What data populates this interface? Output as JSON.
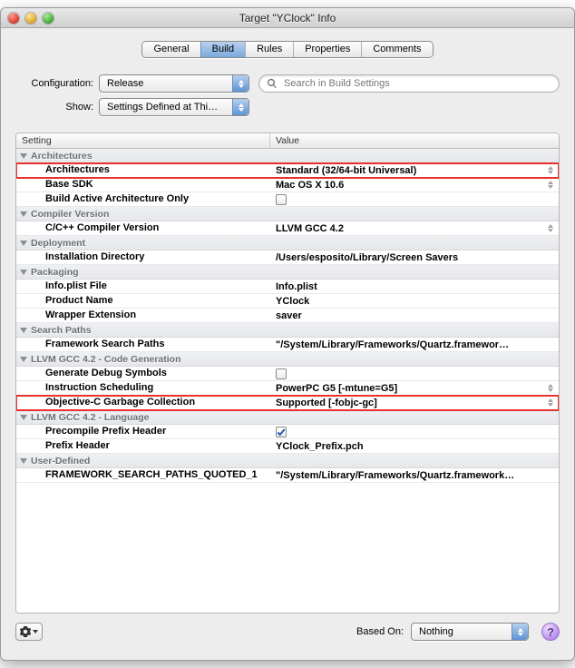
{
  "window": {
    "title": "Target \"YClock\" Info"
  },
  "tabs": [
    "General",
    "Build",
    "Rules",
    "Properties",
    "Comments"
  ],
  "active_tab": 1,
  "config": {
    "label": "Configuration:",
    "value": "Release",
    "show_label": "Show:",
    "show_value": "Settings Defined at Thi…",
    "search_placeholder": "Search in Build Settings"
  },
  "columns": {
    "setting": "Setting",
    "value": "Value"
  },
  "sections": [
    {
      "title": "Architectures",
      "rows": [
        {
          "key": "Architectures",
          "val": "Standard (32/64-bit Universal)",
          "bold": true,
          "hl": true,
          "stepper": true
        },
        {
          "key": "Base SDK",
          "val": "Mac OS X 10.6",
          "bold": true,
          "stepper": true
        },
        {
          "key": "Build Active Architecture Only",
          "val": "",
          "bold": true,
          "check": false
        }
      ]
    },
    {
      "title": "Compiler Version",
      "rows": [
        {
          "key": "C/C++ Compiler Version",
          "val": "LLVM GCC 4.2",
          "bold": true,
          "stepper": true
        }
      ]
    },
    {
      "title": "Deployment",
      "rows": [
        {
          "key": "Installation Directory",
          "val": "/Users/esposito/Library/Screen Savers",
          "bold": true
        }
      ]
    },
    {
      "title": "Packaging",
      "rows": [
        {
          "key": "Info.plist File",
          "val": "Info.plist",
          "bold": true
        },
        {
          "key": "Product Name",
          "val": "YClock",
          "bold": true
        },
        {
          "key": "Wrapper Extension",
          "val": "saver",
          "bold": true
        }
      ]
    },
    {
      "title": "Search Paths",
      "rows": [
        {
          "key": "Framework Search Paths",
          "val": "\"/System/Library/Frameworks/Quartz.framewor…",
          "bold": true
        }
      ]
    },
    {
      "title": "LLVM GCC 4.2 - Code Generation",
      "rows": [
        {
          "key": "Generate Debug Symbols",
          "val": "",
          "bold": true,
          "check": false
        },
        {
          "key": "Instruction Scheduling",
          "val": "PowerPC G5 [-mtune=G5]",
          "bold": true,
          "stepper": true
        },
        {
          "key": "Objective-C Garbage Collection",
          "val": "Supported [-fobjc-gc]",
          "bold": true,
          "hl": true,
          "stepper": true
        }
      ]
    },
    {
      "title": "LLVM GCC 4.2 - Language",
      "rows": [
        {
          "key": "Precompile Prefix Header",
          "val": "",
          "bold": true,
          "check": true
        },
        {
          "key": "Prefix Header",
          "val": "YClock_Prefix.pch",
          "bold": true
        }
      ]
    },
    {
      "title": "User-Defined",
      "rows": [
        {
          "key": "FRAMEWORK_SEARCH_PATHS_QUOTED_1",
          "val": "\"/System/Library/Frameworks/Quartz.framework…",
          "bold": true
        }
      ]
    }
  ],
  "footer": {
    "based_label": "Based On:",
    "based_value": "Nothing"
  }
}
